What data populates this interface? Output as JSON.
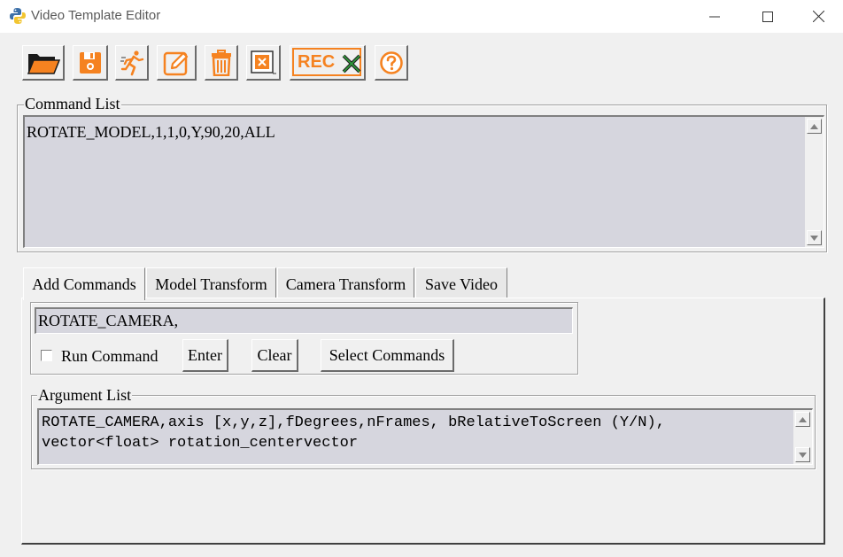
{
  "window": {
    "title": "Video Template Editor"
  },
  "toolbar": {
    "buttons": [
      {
        "name": "open-folder",
        "icon": "folder-open-icon"
      },
      {
        "name": "save",
        "icon": "floppy-disk-icon"
      },
      {
        "name": "run",
        "icon": "running-man-icon"
      },
      {
        "name": "edit",
        "icon": "pencil-edit-icon"
      },
      {
        "name": "delete",
        "icon": "trash-can-icon"
      },
      {
        "name": "remove",
        "icon": "cross-box-icon"
      },
      {
        "name": "record",
        "icon": "rec-cross-icon",
        "label": "REC"
      },
      {
        "name": "help",
        "icon": "question-circle-icon"
      }
    ],
    "accent_color": "#f58220"
  },
  "command_list": {
    "label": "Command List",
    "content": "ROTATE_MODEL,1,1,0,Y,90,20,ALL"
  },
  "tabs": [
    {
      "label": "Add Commands",
      "active": true
    },
    {
      "label": "Model Transform",
      "active": false
    },
    {
      "label": "Camera Transform",
      "active": false
    },
    {
      "label": "Save Video",
      "active": false
    }
  ],
  "add_commands": {
    "command_value": "ROTATE_CAMERA,",
    "run_command_label": "Run Command",
    "run_command_checked": false,
    "enter_label": "Enter",
    "clear_label": "Clear",
    "select_label": "Select Commands"
  },
  "argument_list": {
    "label": "Argument List",
    "content": "ROTATE_CAMERA,axis [x,y,z],fDegrees,nFrames, bRelativeToScreen (Y/N), vector<float> rotation_centervector"
  }
}
